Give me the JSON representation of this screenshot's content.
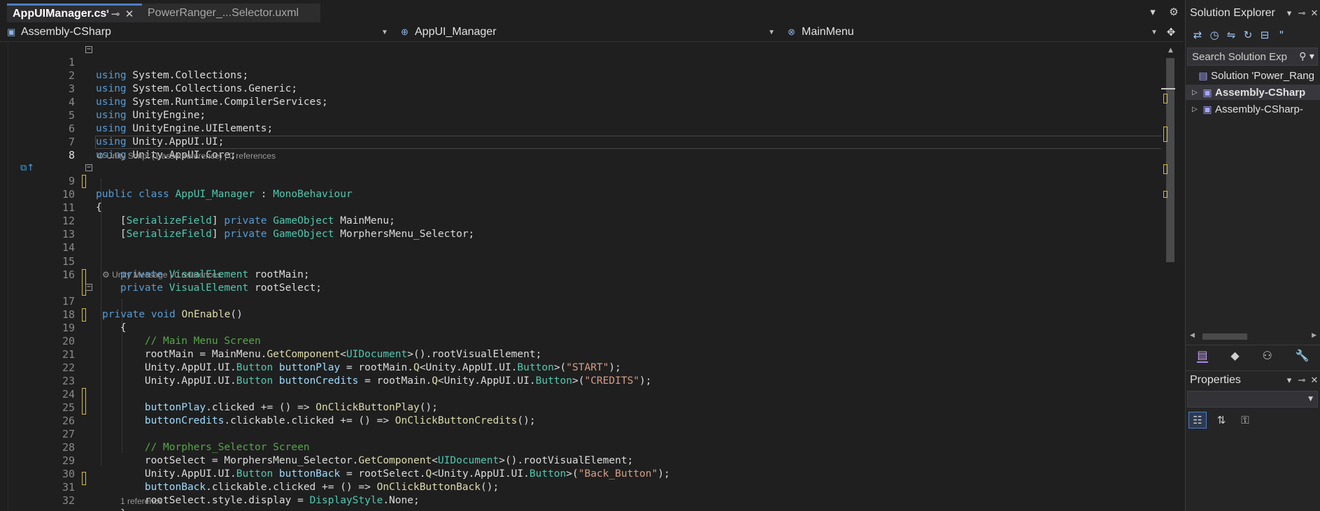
{
  "tabs": [
    {
      "name": "AppUIManager.cs*",
      "pin_icon": "⊸",
      "close_icon": "✕"
    },
    {
      "name": "PowerRanger_...Selector.uxml"
    }
  ],
  "tabstrip_icons": {
    "overflow": "▾",
    "settings": "⚙"
  },
  "navbar": {
    "project": "Assembly-CSharp",
    "type": "AppUI_Manager",
    "member": "MainMenu",
    "split_icon": "✥"
  },
  "code": {
    "lines": [
      "1",
      "2",
      "3",
      "4",
      "5",
      "6",
      "7",
      "8",
      "9",
      "10",
      "11",
      "12",
      "13",
      "14",
      "15",
      "16",
      "17",
      "18",
      "19",
      "20",
      "21",
      "22",
      "23",
      "24",
      "25",
      "26",
      "27",
      "28",
      "29",
      "30",
      "31",
      "32"
    ],
    "lens": {
      "class": "⚙ Unity Script (1 asset reference) | 0 references",
      "onenable": "⚙ Unity Message | 0 references",
      "next": "1 reference"
    },
    "tokens": {
      "using": "using",
      "ns1": "System.Collections;",
      "ns2": "System.Collections.Generic;",
      "ns3": "System.Runtime.CompilerServices;",
      "ns4": "UnityEngine;",
      "ns5": "UnityEngine.UIElements;",
      "ns6": "Unity.AppUI.UI;",
      "ns7": "Unity.AppUI.Core;",
      "public": "public",
      "class": "class",
      "classname": "AppUI_Manager",
      "colon": " : ",
      "base": "MonoBehaviour",
      "open_brace": "{",
      "close_brace": "}",
      "sf_open": "[",
      "sf": "SerializeField",
      "sf_close": "]",
      "private": "private",
      "gameobject": "GameObject",
      "mainmenu_field": "MainMenu;",
      "selector_field": "MorphersMenu_Selector;",
      "visualelement": "VisualElement",
      "rootmain_decl": "rootMain;",
      "rootselect_decl": "rootSelect;",
      "void": "void",
      "onenable": "OnEnable",
      "parens": "()",
      "cm1": "// Main Menu Screen",
      "l20a": "rootMain",
      "l20b": " = MainMenu.",
      "l20c": "GetComponent",
      "l20d": "<",
      "l20e": "UIDocument",
      "l20f": ">().rootVisualElement;",
      "appui_ui": "Unity.AppUI.UI.",
      "button": "Button",
      "buttonplay": "buttonPlay",
      "buttoncredits": "buttonCredits",
      "buttonback": "buttonBack",
      "eq_rootmain_q": " = rootMain.",
      "eq_rootselect_q": " = rootSelect.",
      "q": "Q",
      "lt_appui": "<Unity.AppUI.UI.",
      "gt_open": ">(",
      "str_start": "\"START\"",
      "str_credits": "\"CREDITS\"",
      "str_back": "\"Back_Button\"",
      "close_paren_semi": ");",
      "clicked_plus": ".clicked += () => ",
      "clickable_clicked": ".clickable.clicked += () => ",
      "onclickplay": "OnClickButtonPlay",
      "onclickcredits": "OnClickButtonCredits",
      "onclickback": "OnClickButtonBack",
      "call_end": "();",
      "cm2": "// Morphers_Selector Screen",
      "l28a": "rootSelect",
      "l28b": " = MorphersMenu_Selector.",
      "l31a": "rootSelect",
      "l31b": ".style.display = ",
      "displaystyle": "DisplayStyle",
      "none": ".None;"
    }
  },
  "solution_explorer": {
    "title": "Solution Explorer",
    "search_placeholder": "Search Solution Exp",
    "items": [
      {
        "label": "Solution 'Power_Rang"
      },
      {
        "label": "Assembly-CSharp"
      },
      {
        "label": "Assembly-CSharp-"
      }
    ]
  },
  "properties": {
    "title": "Properties"
  },
  "colors": {
    "accent": "#4c7ec5",
    "keyword": "#569cd6",
    "type": "#4ec9b0",
    "method": "#dcdcaa",
    "string": "#d69d85",
    "comment": "#57a64a",
    "change_marker": "#d7ba3a"
  }
}
